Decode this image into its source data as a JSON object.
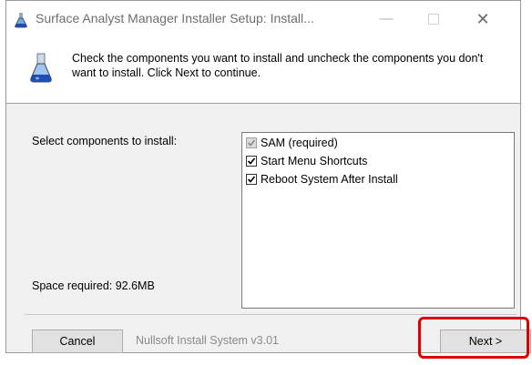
{
  "window": {
    "title": "Surface Analyst Manager Installer Setup: Install...",
    "minimize_glyph": "—",
    "close_glyph": "✕"
  },
  "header": {
    "text": "Check the components you want to install and uncheck the components you don't want to install. Click Next to continue.",
    "icon": "installer-flask-icon"
  },
  "components": {
    "select_label": "Select components to install:",
    "items": [
      {
        "label": "SAM (required)",
        "checked": true,
        "disabled": true
      },
      {
        "label": "Start Menu Shortcuts",
        "checked": true,
        "disabled": false
      },
      {
        "label": "Reboot System After Install",
        "checked": true,
        "disabled": false
      }
    ]
  },
  "space_required": "Space required: 92.6MB",
  "footer": {
    "brand": "Nullsoft Install System v3.01",
    "cancel_label": "Cancel",
    "next_label": "Next >"
  },
  "colors": {
    "highlight": "#e00000",
    "dialog_bg": "#f0f0f0"
  }
}
